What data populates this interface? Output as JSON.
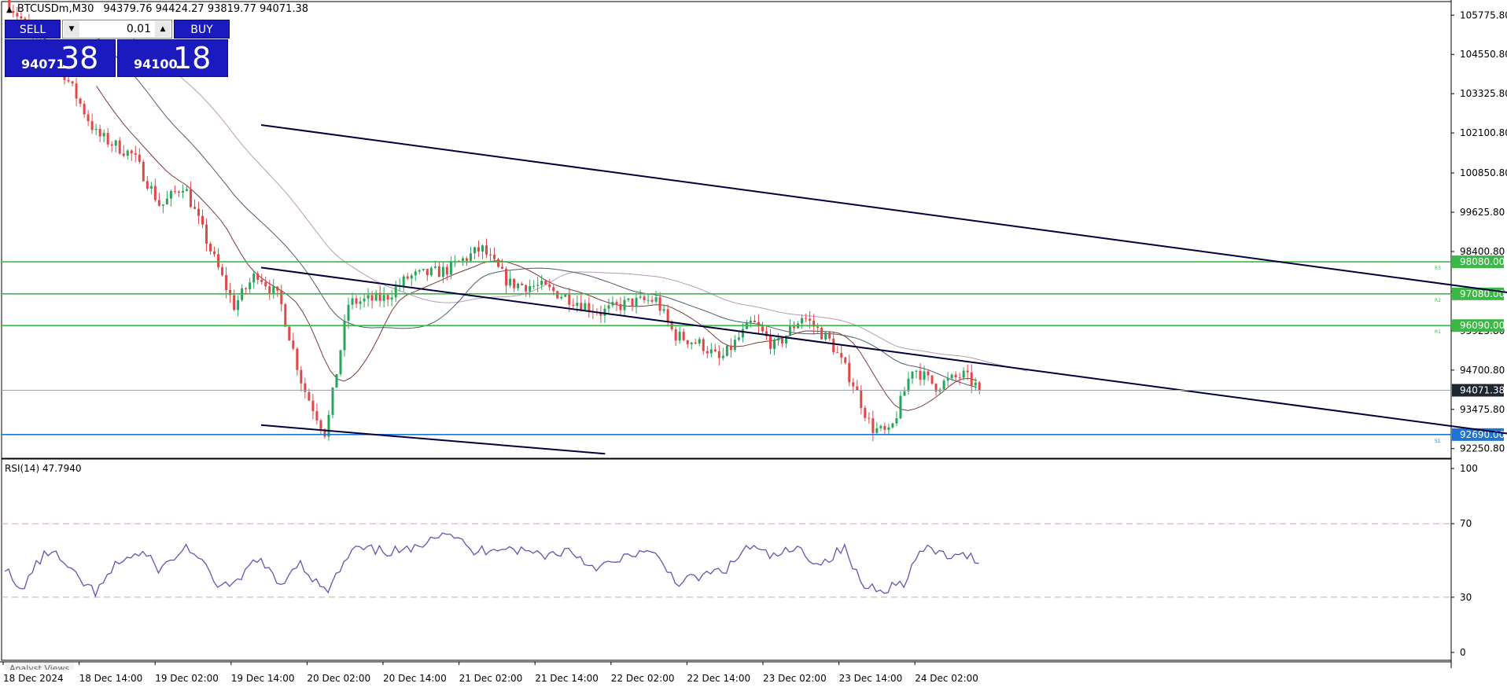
{
  "header": {
    "symbol": "BTCUSDm,M30",
    "ohlc": "94379.76 94424.27 93819.77 94071.38"
  },
  "trade_panel": {
    "sell_label": "SELL",
    "buy_label": "BUY",
    "lot_value": "0.01",
    "sell_price_small": "94071",
    "sell_price_big": "38",
    "buy_price_small": "94100",
    "buy_price_big": "18"
  },
  "rsi": {
    "label": "RSI(14) 47.7940"
  },
  "analyst_tab": "Analyst Views",
  "colors": {
    "bull": "#26a65b",
    "bear": "#e04848",
    "ma_fast": "#7a3a3a",
    "ma_mid": "#4d5a6e",
    "ma_slow": "#b89ab8",
    "rsi_line": "#6b4fb0",
    "channel": "#00003a",
    "support_green": "#3cb846",
    "support_blue": "#1f73d1",
    "price_label_bg": "#1e2630"
  },
  "chart_data": {
    "type": "candlestick",
    "y_ticks": [
      "105775.80",
      "104550.80",
      "103325.80",
      "102100.80",
      "100850.80",
      "99625.80",
      "98400.80",
      "97150.80",
      "95925.80",
      "94700.80",
      "93475.80",
      "92250.80"
    ],
    "ylim": [
      91950,
      106200
    ],
    "x_ticks": [
      "18 Dec 2024",
      "18 Dec 14:00",
      "19 Dec 02:00",
      "19 Dec 14:00",
      "20 Dec 02:00",
      "20 Dec 14:00",
      "21 Dec 02:00",
      "21 Dec 14:00",
      "22 Dec 02:00",
      "22 Dec 14:00",
      "23 Dec 02:00",
      "23 Dec 14:00",
      "24 Dec 02:00"
    ],
    "current_price": "94071.38",
    "horizontal_lines": [
      {
        "value": 98080,
        "label": "98080.00",
        "tag": "R3",
        "color": "green"
      },
      {
        "value": 97080,
        "label": "97080.00",
        "tag": "R2",
        "color": "green"
      },
      {
        "value": 96090,
        "label": "96090.00",
        "tag": "R1",
        "color": "green"
      },
      {
        "value": 92690,
        "label": "92690.00",
        "tag": "S1",
        "color": "blue"
      }
    ],
    "channel_lines": [
      {
        "from": {
          "x_bar": 0.0,
          "y": 102350
        },
        "to": {
          "x_bar": 28.6,
          "y": 96850
        }
      },
      {
        "from": {
          "x_bar": 0.0,
          "y": 97900
        },
        "to": {
          "x_bar": 28.6,
          "y": 92450
        }
      },
      {
        "from": {
          "x_bar": 0.0,
          "y": 92985
        },
        "to": {
          "x_bar": 7.5,
          "y": 92090
        }
      }
    ],
    "close_path": [
      [
        0,
        106300
      ],
      [
        1.3,
        103950
      ],
      [
        2.0,
        102050
      ],
      [
        2.8,
        101400
      ],
      [
        3.4,
        99800
      ],
      [
        3.9,
        100500
      ],
      [
        4.5,
        98400
      ],
      [
        5.0,
        96700
      ],
      [
        5.5,
        97750
      ],
      [
        6.0,
        96900
      ],
      [
        6.5,
        94200
      ],
      [
        7.0,
        92700
      ],
      [
        7.5,
        96800
      ],
      [
        8.3,
        96950
      ],
      [
        8.8,
        97600
      ],
      [
        9.6,
        97800
      ],
      [
        10.4,
        98500
      ],
      [
        11.0,
        97400
      ],
      [
        11.7,
        97300
      ],
      [
        12.4,
        96900
      ],
      [
        13.0,
        96500
      ],
      [
        13.6,
        96800
      ],
      [
        14.2,
        96900
      ],
      [
        14.6,
        95800
      ],
      [
        15.2,
        95500
      ],
      [
        15.6,
        95000
      ],
      [
        16.3,
        96200
      ],
      [
        16.8,
        95400
      ],
      [
        17.4,
        96400
      ],
      [
        18.0,
        95600
      ],
      [
        18.5,
        94300
      ],
      [
        18.9,
        92900
      ],
      [
        19.3,
        92700
      ],
      [
        19.8,
        94800
      ],
      [
        20.3,
        94200
      ],
      [
        20.9,
        94550
      ],
      [
        21.3,
        94071
      ]
    ],
    "rsi": {
      "ylim": [
        0,
        100
      ],
      "levels": [
        70,
        30
      ],
      "tick_labels": [
        "100",
        "70",
        "30",
        "0"
      ],
      "values_path": [
        [
          0,
          47
        ],
        [
          0.3,
          32
        ],
        [
          0.7,
          48
        ],
        [
          1.0,
          56
        ],
        [
          1.5,
          42
        ],
        [
          2.0,
          32
        ],
        [
          2.5,
          50
        ],
        [
          3.0,
          54
        ],
        [
          3.4,
          45
        ],
        [
          4.0,
          58
        ],
        [
          4.6,
          38
        ],
        [
          5.0,
          35
        ],
        [
          5.5,
          52
        ],
        [
          6.0,
          36
        ],
        [
          6.4,
          50
        ],
        [
          7.0,
          32
        ],
        [
          7.6,
          56
        ],
        [
          8.3,
          55
        ],
        [
          8.9,
          55
        ],
        [
          9.3,
          64
        ],
        [
          9.7,
          66
        ],
        [
          10.2,
          54
        ],
        [
          10.8,
          58
        ],
        [
          11.3,
          55
        ],
        [
          11.9,
          53
        ],
        [
          12.3,
          56
        ],
        [
          12.8,
          47
        ],
        [
          13.3,
          48
        ],
        [
          13.8,
          55
        ],
        [
          14.2,
          52
        ],
        [
          14.7,
          38
        ],
        [
          15.3,
          42
        ],
        [
          15.8,
          46
        ],
        [
          16.2,
          58
        ],
        [
          16.7,
          52
        ],
        [
          17.3,
          56
        ],
        [
          17.8,
          48
        ],
        [
          18.3,
          57
        ],
        [
          18.7,
          36
        ],
        [
          19.2,
          35
        ],
        [
          19.6,
          38
        ],
        [
          20.0,
          56
        ],
        [
          20.4,
          54
        ],
        [
          20.8,
          51
        ],
        [
          21.1,
          53
        ],
        [
          21.3,
          48
        ]
      ]
    }
  }
}
